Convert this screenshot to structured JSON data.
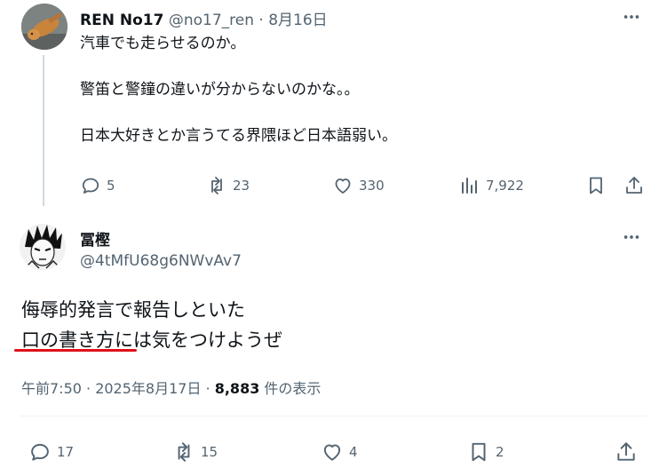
{
  "parent_tweet": {
    "author_name": "REN No17",
    "author_handle": "@no17_ren",
    "dot": "·",
    "date": "8月16日",
    "lines": [
      "汽車でも走らせるのか。",
      "警笛と警鐘の違いが分からないのかな。。",
      "日本大好きとか言うてる界隈ほど日本語弱い。"
    ],
    "actions": {
      "replies": "5",
      "reposts": "23",
      "likes": "330",
      "views": "7,922"
    }
  },
  "reply_tweet": {
    "author_name": "冨樫",
    "author_handle": "@4tMfU68g6NWvAv7",
    "lines": [
      "侮辱的発言で報告しといた",
      "口の書き方には気をつけようぜ"
    ],
    "timestamp": "午前7:50 · 2025年8月17日 · ",
    "view_count": "8,883",
    "view_label": " 件の表示",
    "actions": {
      "replies": "17",
      "reposts": "15",
      "likes": "4",
      "bookmarks": "2"
    }
  },
  "annotation": {
    "underline_color": "#e0101a"
  },
  "icons": [
    "more-icon",
    "reply-icon",
    "repost-icon",
    "like-icon",
    "views-icon",
    "bookmark-icon",
    "share-icon"
  ],
  "colors": {
    "text": "#0f1419",
    "secondary": "#536471",
    "divider": "#eff3f4"
  }
}
